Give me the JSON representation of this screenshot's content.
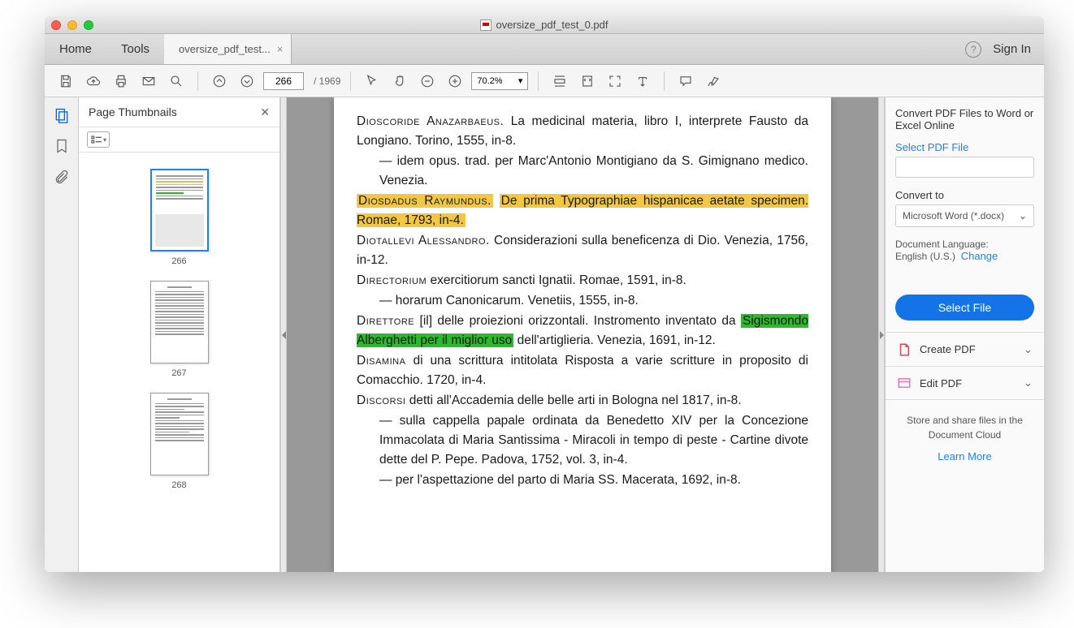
{
  "window": {
    "title": "oversize_pdf_test_0.pdf"
  },
  "tabs": {
    "home": "Home",
    "tools": "Tools",
    "file": "oversize_pdf_test...",
    "signin": "Sign In"
  },
  "toolbar": {
    "page_current": "266",
    "page_total": "/ 1969",
    "zoom": "70.2%"
  },
  "thumbnails": {
    "title": "Page Thumbnails",
    "pages": [
      "266",
      "267",
      "268"
    ]
  },
  "document": {
    "p1a": "Dioscoride Anazarbaeus.",
    "p1b": " La medicinal materia, libro I, interprete Fausto da Longiano. Torino, 1555, in-8.",
    "p2": "— idem opus. trad. per Marc'Antonio Montigiano da S. Gimignano medico. Venezia.",
    "p3_hl1": "Diosdadus Raymundus.",
    "p3_hl2": "De prima Typographiae hispanicae aetate specimen. Romae, 1793, in-4.",
    "p4a": "Diotallevi Alessandro.",
    "p4b": " Considerazioni sulla beneficenza di Dio. Venezia, 1756, in-12.",
    "p5a": "Directorium",
    "p5b": " exercitiorum sancti Ignatii. Romae, 1591, in-8.",
    "p6": "— horarum Canonicarum. Venetiis, 1555, in-8.",
    "p7a": "Direttore",
    "p7b": " [il] delle proiezioni orizzontali. Instromento inventato da ",
    "p7_hl": "Sigismondo Alberghetti per il miglior uso",
    "p7c": " dell'artiglieria. Venezia, 1691, in-12.",
    "p8a": "Disamina",
    "p8b": " di una scrittura intitolata Risposta a varie scritture in proposito di Comacchio. 1720, in-4.",
    "p9a": "Discorsi",
    "p9b": " detti all'Accademia delle belle arti in Bologna nel 1817, in-8.",
    "p10": "— sulla cappella papale ordinata da Benedetto XIV per la Concezione Immacolata di Maria Santissima - Miracoli in tempo di peste - Cartine divote dette del P. Pepe. Padova, 1752, vol. 3, in-4.",
    "p11": "— per l'aspettazione del parto di Maria SS. Macerata, 1692, in-8."
  },
  "rightpanel": {
    "convert_title": "Convert PDF Files to Word or Excel Online",
    "select_pdf": "Select PDF File",
    "convert_to": "Convert to",
    "convert_fmt": "Microsoft Word (*.docx)",
    "doc_lang_label": "Document Language:",
    "doc_lang": "English (U.S.)",
    "change": "Change",
    "select_file_btn": "Select File",
    "create_pdf": "Create PDF",
    "edit_pdf": "Edit PDF",
    "store_text": "Store and share files in the Document Cloud",
    "learn_more": "Learn More"
  }
}
